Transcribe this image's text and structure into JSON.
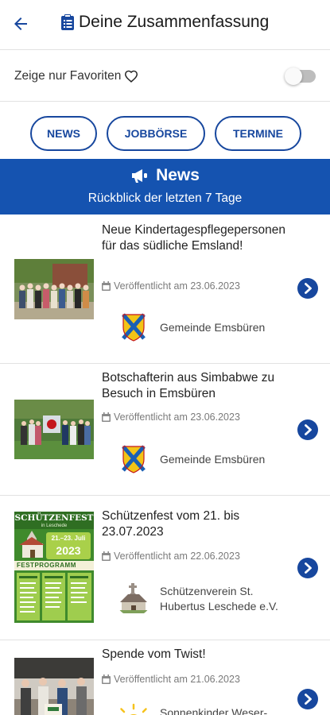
{
  "header": {
    "back_icon": "arrow-left-icon",
    "title_icon": "clipboard-icon",
    "title": "Deine Zusammenfassung"
  },
  "filter": {
    "label": "Zeige nur Favoriten",
    "icon": "heart-outline-icon",
    "favorites_only": false
  },
  "chips": [
    "NEWS",
    "JOBBÖRSE",
    "TERMINE"
  ],
  "banner": {
    "icon": "megaphone-icon",
    "title": "News",
    "subtitle": "Rückblick der letzten 7 Tage"
  },
  "colors": {
    "accent": "#17479e",
    "banner": "#1553b0"
  },
  "news": [
    {
      "title": "Neue Kindertagespflegepersonen für das südliche Emsland!",
      "date": "Veröffentlicht am 23.06.2023",
      "org": "Gemeinde Emsbüren"
    },
    {
      "title": "Botschafterin aus Simbabwe zu Besuch in Emsbüren",
      "date": "Veröffentlicht am 23.06.2023",
      "org": "Gemeinde Emsbüren"
    },
    {
      "title": "Schützenfest vom 21. bis 23.07.2023",
      "date": "Veröffentlicht am 22.06.2023",
      "org": "Schützenverein St. Hubertus Leschede e.V.",
      "poster": {
        "heading": "SCHÜTZENFEST",
        "place": "in Leschede",
        "dates": "21.–23. Juli",
        "year": "2023",
        "program": "FESTPROGRAMM"
      }
    },
    {
      "title": "Spende vom Twist!",
      "date": "Veröffentlicht am 21.06.2023",
      "org": "Sonnenkinder Weser-"
    }
  ]
}
